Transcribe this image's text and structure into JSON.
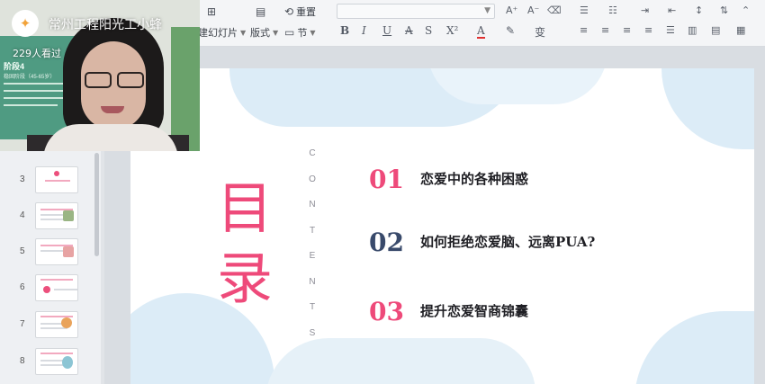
{
  "stream": {
    "channel_name": "常州工程阳光工小蜂",
    "viewer_count": "229人看过",
    "poster_title": "阶段4",
    "poster_subtitle": "稳固阶段（45-65岁）"
  },
  "ribbon": {
    "new_slide_label": "建幻灯片",
    "layout_label": "版式",
    "section_label": "节",
    "reset_label": "重置",
    "colors": {
      "accent": "#ee4a7a",
      "dark_number": "#394a6b"
    }
  },
  "thumbnails": [
    {
      "number": "3",
      "style": "title"
    },
    {
      "number": "4",
      "style": "text-pic"
    },
    {
      "number": "5",
      "style": "text-pic"
    },
    {
      "number": "6",
      "style": "dot"
    },
    {
      "number": "7",
      "style": "sun"
    },
    {
      "number": "8",
      "style": "oval"
    }
  ],
  "slide": {
    "title_char_1": "目",
    "title_char_2": "录",
    "contents_letters": [
      "C",
      "O",
      "N",
      "T",
      "E",
      "N",
      "T",
      "S"
    ],
    "items": [
      {
        "number": "01",
        "text": "恋爱中的各种困惑",
        "color": "#ee4a7a"
      },
      {
        "number": "02",
        "text": "如何拒绝恋爱脑、远离PUA?",
        "color": "#394a6b"
      },
      {
        "number": "03",
        "text": "提升恋爱智商锦囊",
        "color": "#ee4a7a"
      }
    ]
  }
}
